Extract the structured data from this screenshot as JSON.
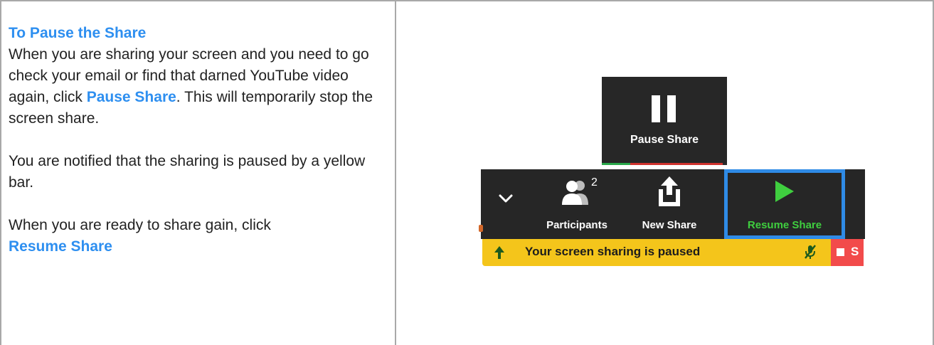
{
  "instructions": {
    "heading": "To Pause the Share",
    "p1_part1": "When you are sharing your screen and you need to go check your email or find that darned YouTube video again, click ",
    "p1_keyword": "Pause Share",
    "p1_part2": ". This will temporarily stop the screen share.",
    "p2": "You are notified that the sharing is paused by a yellow bar.",
    "p3_part1": "When you are ready to share gain, click ",
    "p3_keyword": "Resume Share"
  },
  "zoom": {
    "pause_button_label": "Pause Share",
    "participants_label": "Participants",
    "participants_count": "2",
    "new_share_label": "New Share",
    "resume_share_label": "Resume Share",
    "paused_banner_text": "Your screen sharing is paused",
    "stop_share_partial": "S"
  },
  "colors": {
    "accent_text": "#2e8ff0",
    "highlight_border": "#2f8be6",
    "resume_green": "#3fce3f",
    "banner_yellow": "#f4c51b",
    "stop_red": "#f24b4b",
    "toolbar_bg": "#262626"
  }
}
